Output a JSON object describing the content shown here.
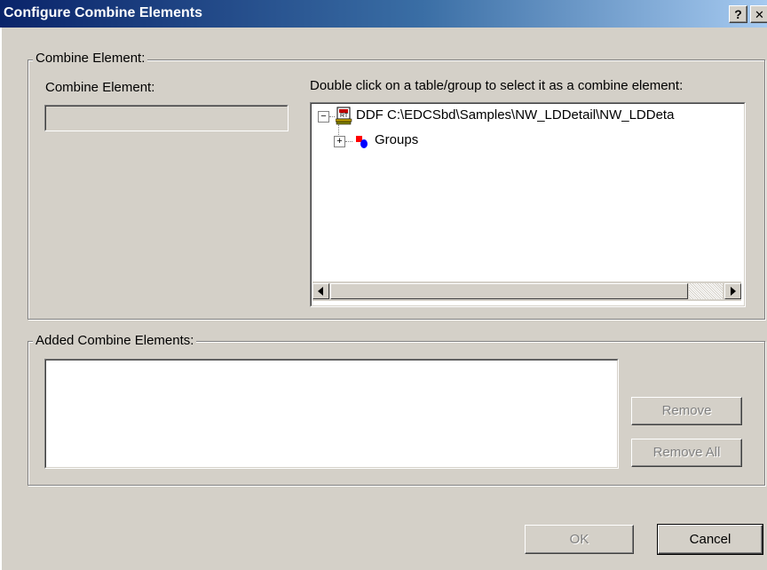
{
  "window": {
    "title": "Configure Combine Elements",
    "help_glyph": "?",
    "close_glyph": "✕"
  },
  "combine_group": {
    "legend": "Combine Element:",
    "field_label": "Combine Element:",
    "field_value": "",
    "tree_instruction": "Double click on a table/group to select it as a combine element:",
    "tree": {
      "root": {
        "expander": "−",
        "icon": "ddf-file-icon",
        "label": "DDF C:\\EDCSbd\\Samples\\NW_LDDetail\\NW_LDDeta"
      },
      "child": {
        "expander": "+",
        "icon": "groups-icon",
        "label": "Groups"
      }
    }
  },
  "added_group": {
    "legend": "Added Combine Elements:",
    "items": []
  },
  "buttons": {
    "remove": "Remove",
    "remove_all": "Remove All",
    "ok": "OK",
    "cancel": "Cancel"
  },
  "colors": {
    "face": "#d4d0c8",
    "title_start": "#0a246a",
    "title_end": "#a6caf0",
    "disabled_text": "#808080"
  }
}
